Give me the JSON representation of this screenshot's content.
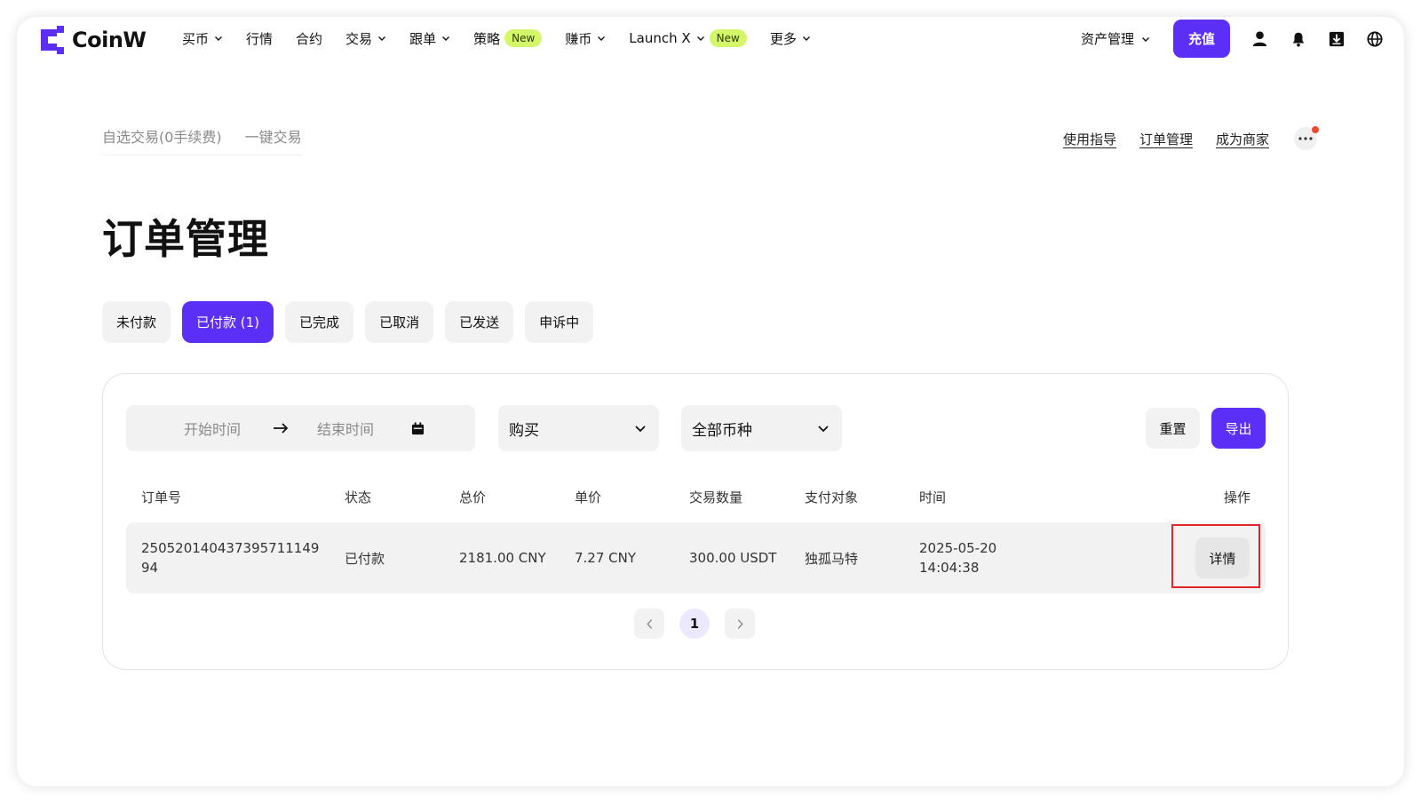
{
  "brand": {
    "name": "CoinW",
    "accent": "#5b2ff5"
  },
  "nav": {
    "items": [
      {
        "label": "买币",
        "dropdown": true
      },
      {
        "label": "行情",
        "dropdown": false
      },
      {
        "label": "合约",
        "dropdown": false
      },
      {
        "label": "交易",
        "dropdown": true
      },
      {
        "label": "跟单",
        "dropdown": true
      },
      {
        "label": "策略",
        "badge": "New",
        "dropdown": false
      },
      {
        "label": "赚币",
        "dropdown": true
      },
      {
        "label": "Launch X",
        "badge": "New",
        "dropdown": true
      },
      {
        "label": "更多",
        "dropdown": true
      }
    ],
    "asset_management": "资产管理",
    "recharge": "充值",
    "icons": [
      "user-icon",
      "bell-icon",
      "download-icon",
      "globe-icon"
    ]
  },
  "subheader": {
    "tabs": [
      "自选交易(0手续费)",
      "一键交易"
    ],
    "links": [
      "使用指导",
      "订单管理",
      "成为商家"
    ]
  },
  "page": {
    "title": "订单管理"
  },
  "status_tabs": [
    {
      "label": "未付款",
      "active": false
    },
    {
      "label": "已付款 (1)",
      "active": true
    },
    {
      "label": "已完成",
      "active": false
    },
    {
      "label": "已取消",
      "active": false
    },
    {
      "label": "已发送",
      "active": false
    },
    {
      "label": "申诉中",
      "active": false
    }
  ],
  "filters": {
    "start_placeholder": "开始时间",
    "end_placeholder": "结束时间",
    "type_selected": "购买",
    "coin_selected": "全部币种",
    "reset": "重置",
    "export": "导出"
  },
  "table": {
    "headers": [
      "订单号",
      "状态",
      "总价",
      "单价",
      "交易数量",
      "支付对象",
      "时间",
      "操作"
    ],
    "rows": [
      {
        "order_no_line1": "250520140437395711149",
        "order_no_line2": "94",
        "status": "已付款",
        "total": "2181.00 CNY",
        "unit_price": "7.27 CNY",
        "quantity": "300.00 USDT",
        "payee": "独孤马特",
        "date": "2025-05-20",
        "time": "14:04:38",
        "action": "详情"
      }
    ]
  },
  "pagination": {
    "current": "1"
  }
}
